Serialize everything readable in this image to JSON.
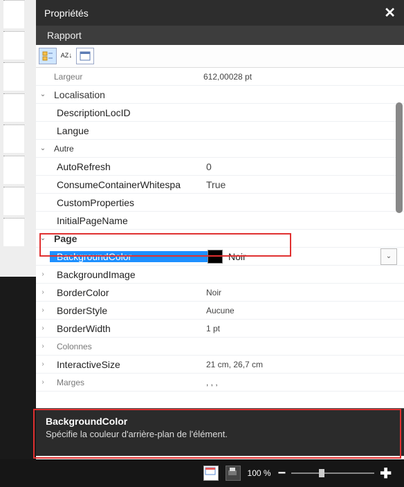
{
  "panel": {
    "title": "Propriétés",
    "object": "Rapport"
  },
  "props": {
    "largeur": {
      "label": "Largeur",
      "value": "612,00028 pt"
    },
    "localisation": {
      "label": "Localisation"
    },
    "descLocId": {
      "label": "DescriptionLocID",
      "value": ""
    },
    "langue": {
      "label": "Langue",
      "value": ""
    },
    "autre": {
      "label": "Autre"
    },
    "autoRefresh": {
      "label": "AutoRefresh",
      "value": "0"
    },
    "consume": {
      "label": "ConsumeContainerWhitespa",
      "value": "True"
    },
    "custom": {
      "label": "CustomProperties",
      "value": ""
    },
    "initialPage": {
      "label": "InitialPageName",
      "value": ""
    },
    "page": {
      "label": "Page"
    },
    "bgcolor": {
      "label": "BackgroundColor",
      "value": "Noir"
    },
    "bgimage": {
      "label": "BackgroundImage",
      "value": ""
    },
    "borderColor": {
      "label": "BorderColor",
      "value": "Noir"
    },
    "borderStyle": {
      "label": "BorderStyle",
      "value": "Aucune"
    },
    "borderWidth": {
      "label": "BorderWidth",
      "value": "1 pt"
    },
    "colonnes": {
      "label": "Colonnes"
    },
    "interactive": {
      "label": "InteractiveSize",
      "value": "21 cm, 26,7 cm"
    },
    "marges": {
      "label": "Marges",
      "value": ", , ,"
    }
  },
  "description": {
    "title": "BackgroundColor",
    "text": "Spécifie la couleur d'arrière-plan de l'élément."
  },
  "status": {
    "zoom": "100 %"
  },
  "icons": {
    "chevDown": "⌄",
    "chevRight": "›",
    "close": "✕",
    "sort": "A↓",
    "cat": "☰",
    "page": "▭"
  }
}
